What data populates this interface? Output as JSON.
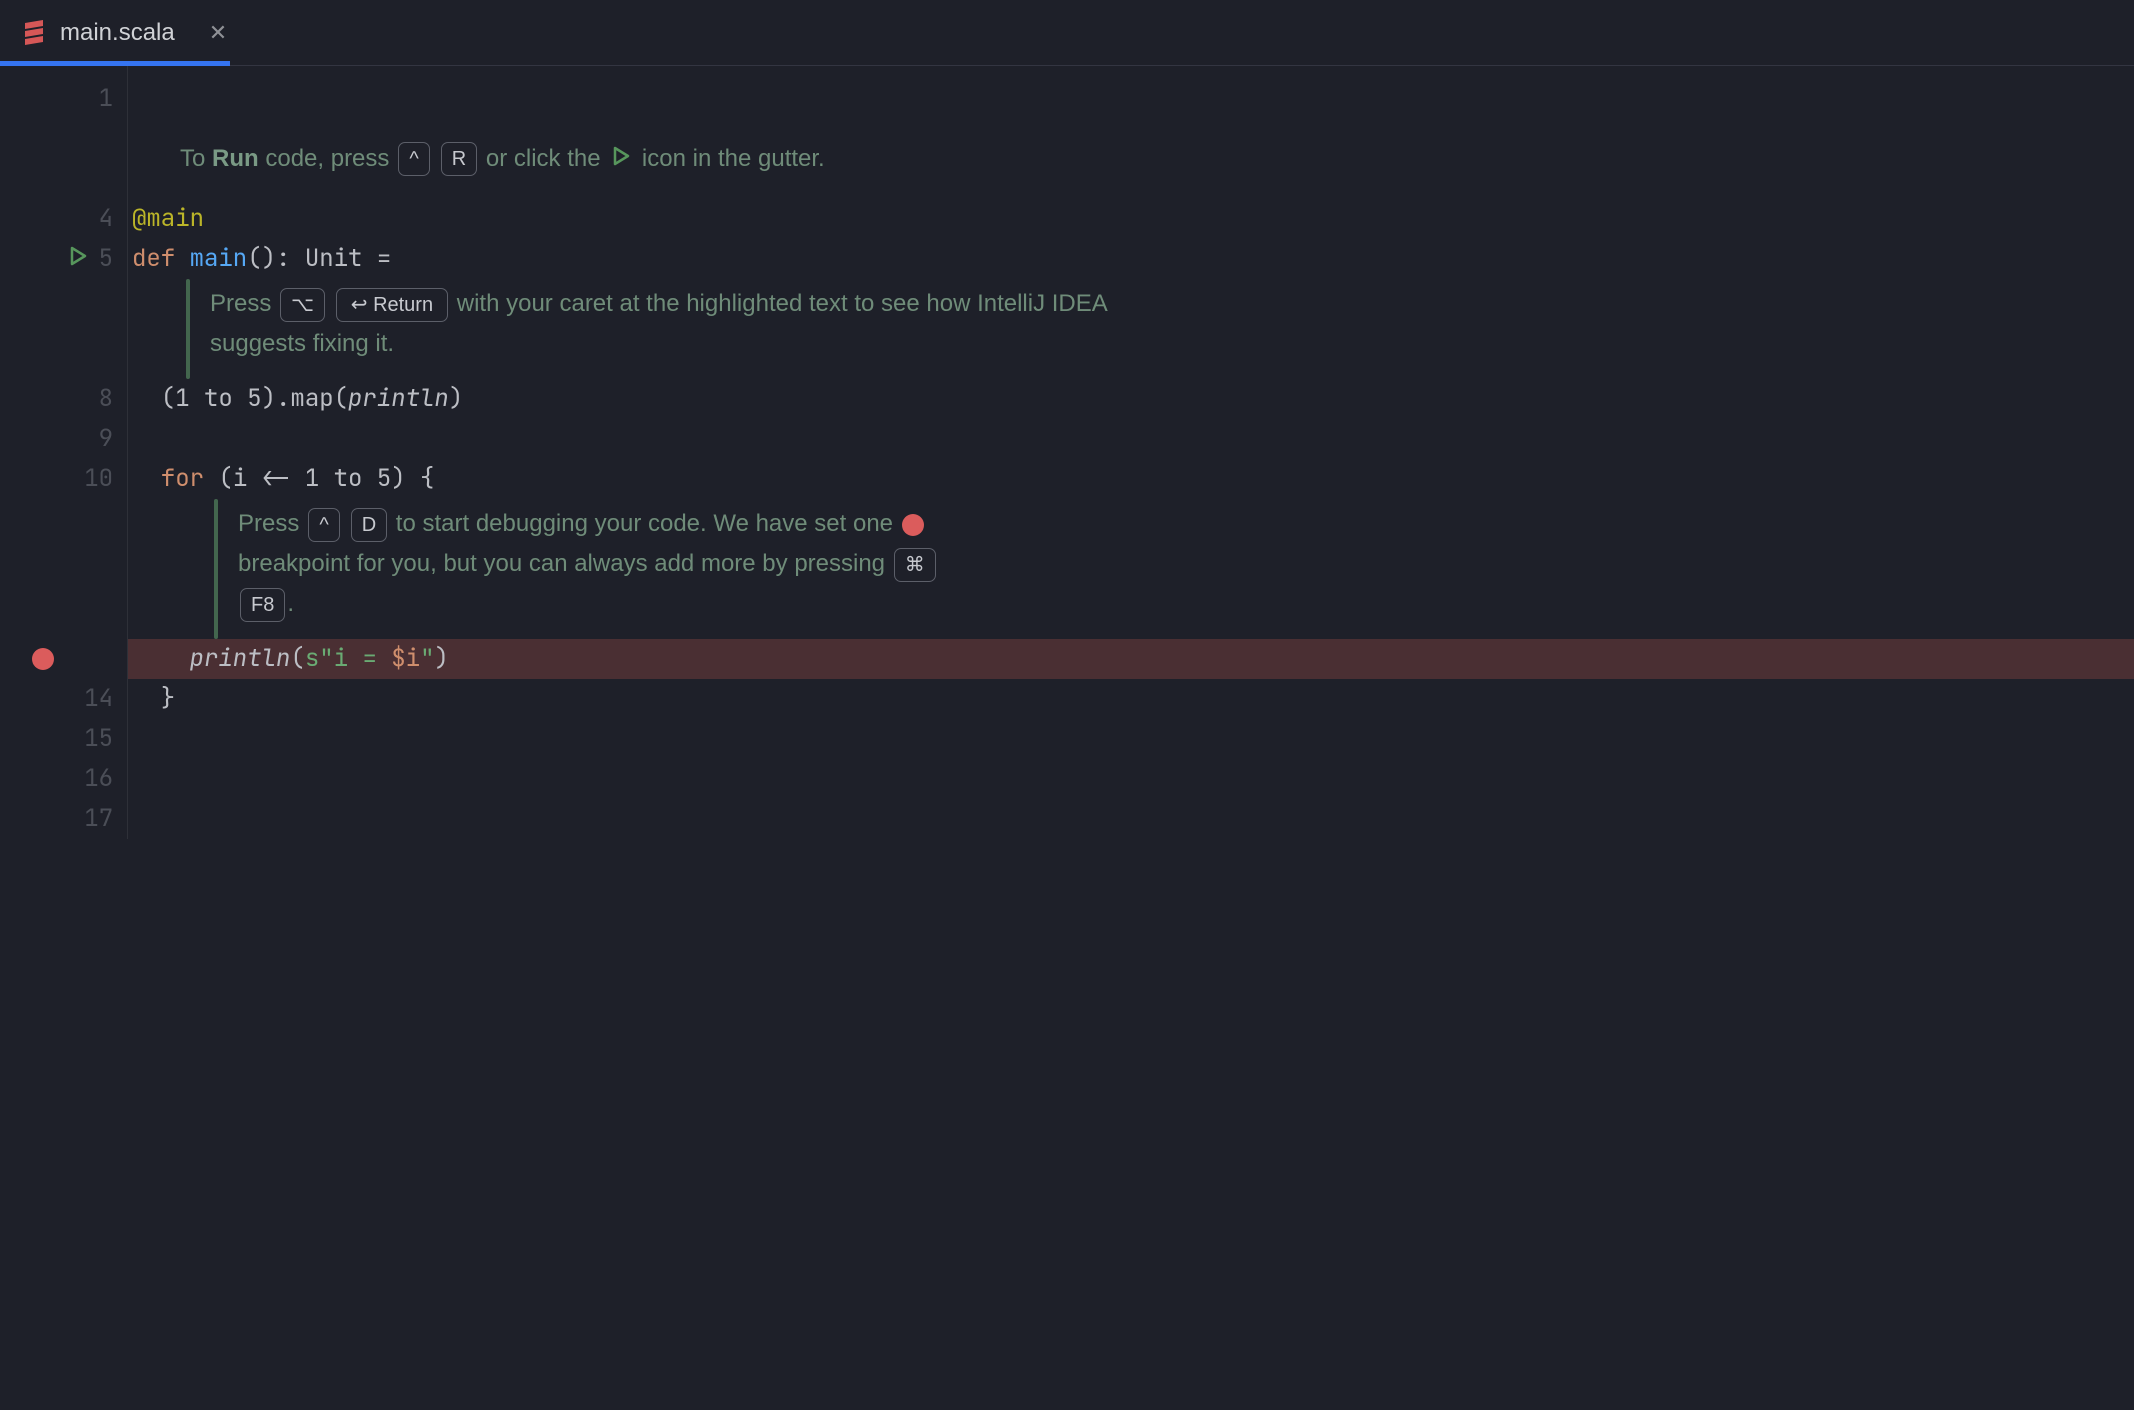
{
  "tab": {
    "filename": "main.scala",
    "close_tooltip": "Close"
  },
  "gutter": {
    "line_numbers": [
      "1",
      "",
      "",
      "4",
      "5",
      "",
      "",
      "8",
      "9",
      "10",
      "",
      "",
      "",
      "14",
      "15",
      "16",
      "17"
    ]
  },
  "hints": {
    "run": {
      "part1": "To ",
      "bold": "Run",
      "part2": " code, press ",
      "key1": "^",
      "key2": "R",
      "part3": " or click the ",
      "part4": " icon in the gutter."
    },
    "fix": {
      "part1": "Press ",
      "key1": "⌥",
      "key2_symbol": "↩",
      "key2_label": "Return",
      "part2": " with your caret at the highlighted text to see how IntelliJ IDEA suggests fixing it."
    },
    "debug": {
      "part1": "Press ",
      "key1": "^",
      "key2": "D",
      "part2": " to start debugging your code. We have set one ",
      "part3": " breakpoint for you, but you can always add more by pressing ",
      "key3": "⌘",
      "key4": "F8",
      "part4": "."
    }
  },
  "code": {
    "line4": {
      "anno": "@main"
    },
    "line5": {
      "kw": "def ",
      "name": "main",
      "rest1": "(): ",
      "type": "Unit",
      "rest2": " ="
    },
    "line8": {
      "open": "  (",
      "n1": "1",
      "to": " to ",
      "n2": "5",
      "mid": ").map(",
      "fn": "println",
      "close": ")"
    },
    "line10": {
      "kw": "  for ",
      "open": "(",
      "var": "i",
      "arrow": " <- ",
      "n1": "1",
      "to": " to ",
      "n2": "5",
      "close": ") {"
    },
    "line13": {
      "indent": "    ",
      "fn": "println",
      "open": "(",
      "prefix": "s",
      "str_open": "\"",
      "str_body": "i = ",
      "interp": "$i",
      "str_close": "\"",
      "close": ")"
    },
    "line14": {
      "text": "  }"
    }
  }
}
